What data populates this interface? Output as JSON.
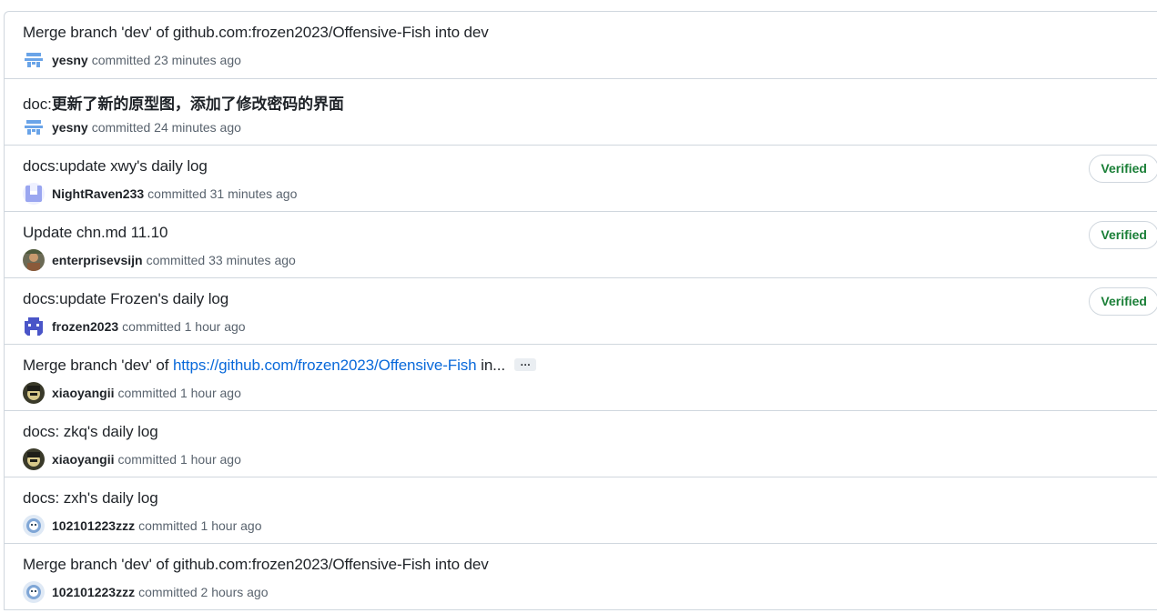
{
  "commits": [
    {
      "message": "Merge branch 'dev' of github.com:frozen2023/Offensive-Fish into dev",
      "author": "yesny",
      "verb": "committed",
      "time": "23 minutes ago",
      "avatar": "avatar-pixel-blue",
      "verified": ""
    },
    {
      "message_prefix": "doc:",
      "message_cjk": "更新了新的原型图，添加了修改密码的界面",
      "author": "yesny",
      "verb": "committed",
      "time": "24 minutes ago",
      "avatar": "avatar-pixel-blue",
      "verified": ""
    },
    {
      "message": "docs:update xwy's daily log",
      "author": "NightRaven233",
      "verb": "committed",
      "time": "31 minutes ago",
      "avatar": "avatar-pixel-lavender",
      "verified": "Verified"
    },
    {
      "message": "Update chn.md 11.10",
      "author": "enterprisevsijn",
      "verb": "committed",
      "time": "33 minutes ago",
      "avatar": "avatar-photo-brown",
      "verified": "Verified"
    },
    {
      "message": "docs:update Frozen's daily log",
      "author": "frozen2023",
      "verb": "committed",
      "time": "1 hour ago",
      "avatar": "avatar-pixel-indigo",
      "verified": "Verified"
    },
    {
      "message_prefix": "Merge branch 'dev' of ",
      "message_link": "https://github.com/frozen2023/Offensive-Fish",
      "message_suffix": " in...",
      "ellipsis": "…",
      "author": "xiaoyangii",
      "verb": "committed",
      "time": "1 hour ago",
      "avatar": "avatar-photo-dark",
      "verified": ""
    },
    {
      "message": "docs: zkq's daily log",
      "author": "xiaoyangii",
      "verb": "committed",
      "time": "1 hour ago",
      "avatar": "avatar-photo-dark",
      "verified": ""
    },
    {
      "message": "docs: zxh's daily log",
      "author": "102101223zzz",
      "verb": "committed",
      "time": "1 hour ago",
      "avatar": "avatar-photo-light",
      "verified": ""
    },
    {
      "message": "Merge branch 'dev' of github.com:frozen2023/Offensive-Fish into dev",
      "author": "102101223zzz",
      "verb": "committed",
      "time": "2 hours ago",
      "avatar": "avatar-photo-light",
      "verified": ""
    }
  ],
  "colors": {
    "verified_green": "#1a7f37",
    "link_blue": "#0969da",
    "border": "#d0d7de",
    "muted_text": "#59636e"
  }
}
